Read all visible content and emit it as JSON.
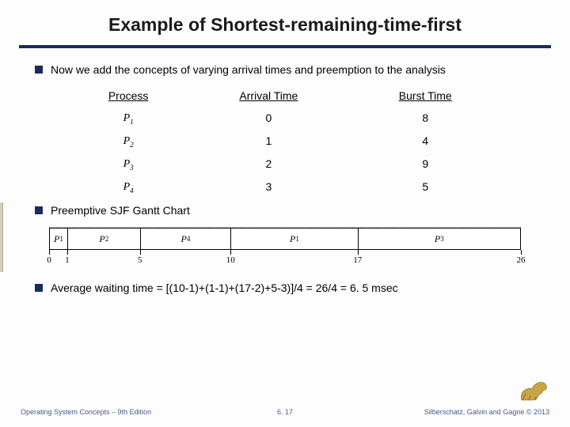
{
  "title": "Example of Shortest-remaining-time-first",
  "bullets": {
    "intro": "Now we add the concepts of varying arrival times and preemption to the analysis",
    "gantt_label": "Preemptive SJF Gantt Chart",
    "avg": "Average waiting time = [(10-1)+(1-1)+(17-2)+5-3)]/4 = 26/4 = 6. 5 msec"
  },
  "table": {
    "headers": {
      "process": "Process",
      "arrival": "Arrival Time",
      "burst": "Burst Time"
    },
    "rows": [
      {
        "p": "P",
        "sub": "1",
        "arrival": "0",
        "burst": "8"
      },
      {
        "p": "P",
        "sub": "2",
        "arrival": "1",
        "burst": "4"
      },
      {
        "p": "P",
        "sub": "3",
        "arrival": "2",
        "burst": "9"
      },
      {
        "p": "P",
        "sub": "4",
        "arrival": "3",
        "burst": "5"
      }
    ]
  },
  "gantt": {
    "total": 26,
    "segments": [
      {
        "label": "P",
        "sub": "1",
        "start": 0,
        "end": 1
      },
      {
        "label": "P",
        "sub": "2",
        "start": 1,
        "end": 5
      },
      {
        "label": "P",
        "sub": "4",
        "start": 5,
        "end": 10
      },
      {
        "label": "P",
        "sub": "1",
        "start": 10,
        "end": 17
      },
      {
        "label": "P",
        "sub": "3",
        "start": 17,
        "end": 26
      }
    ],
    "ticks": [
      "0",
      "1",
      "5",
      "10",
      "17",
      "26"
    ]
  },
  "footer": {
    "left": "Operating System Concepts – 9th Edition",
    "center": "6. 17",
    "right": "Silberschatz, Galvin and Gagne © 2013"
  }
}
